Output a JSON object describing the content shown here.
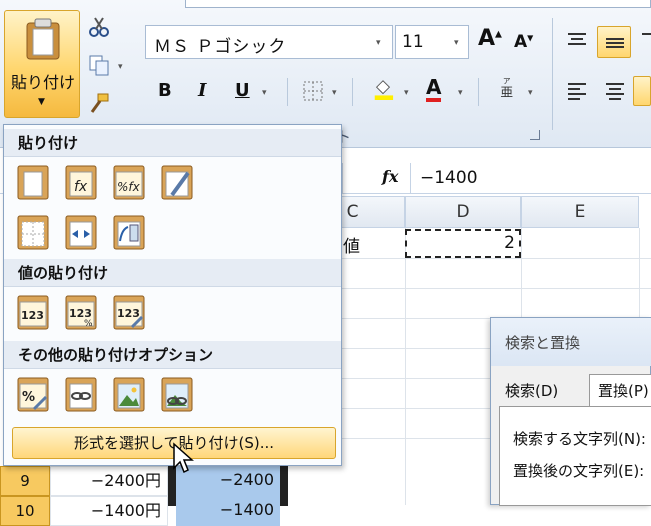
{
  "ribbon": {
    "paste_label": "貼り付け",
    "paste_arrow": "▼",
    "font_name": "ＭＳ Ｐゴシック",
    "font_size": "11",
    "bold": "B",
    "italic": "I",
    "underline": "U",
    "group_label_fragment": "ト",
    "dd": "▾"
  },
  "formula_bar": {
    "fx": "fx",
    "value": "−1400"
  },
  "columns": [
    "C",
    "D",
    "E"
  ],
  "cells": {
    "c_text": "値",
    "d_value": "2"
  },
  "bottom_rows": [
    {
      "num": "9",
      "b": "−2400円",
      "c": "−2400"
    },
    {
      "num": "10",
      "b": "−1400円",
      "c": "−1400"
    }
  ],
  "paste_menu": {
    "section_paste": "貼り付け",
    "section_values": "値の貼り付け",
    "section_other": "その他の貼り付けオプション",
    "paste_special": "形式を選択して貼り付け(S)..."
  },
  "dialog": {
    "title": "検索と置換",
    "tab_find": "検索(D)",
    "tab_replace": "置換(P)",
    "find_label": "検索する文字列(N):",
    "replace_label": "置換後の文字列(E):"
  },
  "colors": {
    "accent": "#ffd66e",
    "selection": "#a9c9ec",
    "ribbon": "#dfe8f3"
  }
}
